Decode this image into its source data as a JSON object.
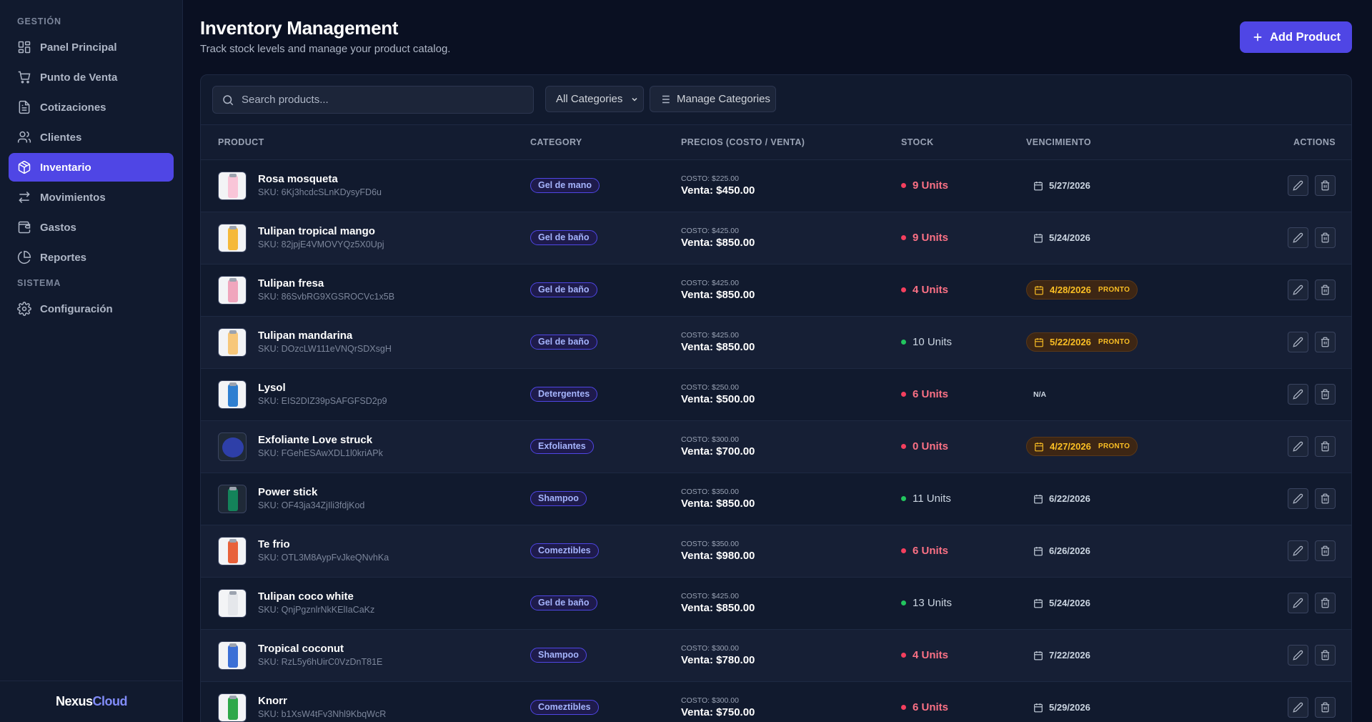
{
  "sidebar": {
    "section_main": "GESTIÓN",
    "section_system": "SISTEMA",
    "items": [
      {
        "label": "Panel Principal",
        "icon": "grid-icon"
      },
      {
        "label": "Punto de Venta",
        "icon": "cart-icon"
      },
      {
        "label": "Cotizaciones",
        "icon": "document-icon"
      },
      {
        "label": "Clientes",
        "icon": "users-icon"
      },
      {
        "label": "Inventario",
        "icon": "box-icon",
        "active": true
      },
      {
        "label": "Movimientos",
        "icon": "arrows-icon"
      },
      {
        "label": "Gastos",
        "icon": "wallet-icon"
      },
      {
        "label": "Reportes",
        "icon": "pie-chart-icon"
      }
    ],
    "system_items": [
      {
        "label": "Configuración",
        "icon": "gear-icon"
      }
    ],
    "brand_part1": "Nexus",
    "brand_part2": "Cloud"
  },
  "header": {
    "title": "Inventory Management",
    "subtitle": "Track stock levels and manage your product catalog.",
    "add_label": "Add Product"
  },
  "toolbar": {
    "search_placeholder": "Search products...",
    "category_filter": "All Categories",
    "manage_label": "Manage Categories"
  },
  "table": {
    "columns": [
      "PRODUCT",
      "CATEGORY",
      "PRECIOS (COSTO / VENTA)",
      "STOCK",
      "VENCIMIENTO",
      "ACTIONS"
    ],
    "rows": [
      {
        "name": "Rosa mosqueta",
        "sku": "SKU: 6Kj3hcdcSLnKDysyFD6u",
        "category": "Gel de mano",
        "cost": "COSTO: $225.00",
        "price": "Venta: $450.00",
        "stock": "9 Units",
        "stock_level": "low",
        "expiry": "5/27/2026",
        "soon": false,
        "thumb_color": "#f9c5d8"
      },
      {
        "name": "Tulipan tropical mango",
        "sku": "SKU: 82jpjE4VMOVYQz5X0Upj",
        "category": "Gel de baño",
        "cost": "COSTO: $425.00",
        "price": "Venta: $850.00",
        "stock": "9 Units",
        "stock_level": "low",
        "expiry": "5/24/2026",
        "soon": false,
        "thumb_color": "#f5b93a"
      },
      {
        "name": "Tulipan fresa",
        "sku": "SKU: 86SvbRG9XGSROCVc1x5B",
        "category": "Gel de baño",
        "cost": "COSTO: $425.00",
        "price": "Venta: $850.00",
        "stock": "4 Units",
        "stock_level": "low",
        "expiry": "4/28/2026",
        "soon": true,
        "thumb_color": "#f0a6bd"
      },
      {
        "name": "Tulipan mandarina",
        "sku": "SKU: DOzcLW111eVNQrSDXsgH",
        "category": "Gel de baño",
        "cost": "COSTO: $425.00",
        "price": "Venta: $850.00",
        "stock": "10 Units",
        "stock_level": "ok",
        "expiry": "5/22/2026",
        "soon": true,
        "thumb_color": "#f7c77a"
      },
      {
        "name": "Lysol",
        "sku": "SKU: EIS2DIZ39pSAFGFSD2p9",
        "category": "Detergentes",
        "cost": "COSTO: $250.00",
        "price": "Venta: $500.00",
        "stock": "6 Units",
        "stock_level": "low",
        "expiry": "N/A",
        "soon": false,
        "na": true,
        "thumb_color": "#2f7fd1"
      },
      {
        "name": "Exfoliante Love struck",
        "sku": "SKU: FGehESAwXDL1l0kriAPk",
        "category": "Exfoliantes",
        "cost": "COSTO: $300.00",
        "price": "Venta: $700.00",
        "stock": "0 Units",
        "stock_level": "low",
        "expiry": "4/27/2026",
        "soon": true,
        "thumb_color": "#2e3fa8",
        "round": true
      },
      {
        "name": "Power stick",
        "sku": "SKU: OF43ja34ZjIli3fdjKod",
        "category": "Shampoo",
        "cost": "COSTO: $350.00",
        "price": "Venta: $850.00",
        "stock": "11 Units",
        "stock_level": "ok",
        "expiry": "6/22/2026",
        "soon": false,
        "thumb_color": "#14835a",
        "dark": true
      },
      {
        "name": "Te frio",
        "sku": "SKU: OTL3M8AypFvJkeQNvhKa",
        "category": "Comeztibles",
        "cost": "COSTO: $350.00",
        "price": "Venta: $980.00",
        "stock": "6 Units",
        "stock_level": "low",
        "expiry": "6/26/2026",
        "soon": false,
        "thumb_color": "#e8613a"
      },
      {
        "name": "Tulipan coco white",
        "sku": "SKU: QnjPgznlrNkKElIaCaKz",
        "category": "Gel de baño",
        "cost": "COSTO: $425.00",
        "price": "Venta: $850.00",
        "stock": "13 Units",
        "stock_level": "ok",
        "expiry": "5/24/2026",
        "soon": false,
        "thumb_color": "#e5e7eb"
      },
      {
        "name": "Tropical coconut",
        "sku": "SKU: RzL5y6hUirC0VzDnT81E",
        "category": "Shampoo",
        "cost": "COSTO: $300.00",
        "price": "Venta: $780.00",
        "stock": "4 Units",
        "stock_level": "low",
        "expiry": "7/22/2026",
        "soon": false,
        "thumb_color": "#3b6fd6"
      },
      {
        "name": "Knorr",
        "sku": "SKU: b1XsW4tFv3Nhl9KbqWcR",
        "category": "Comeztibles",
        "cost": "COSTO: $300.00",
        "price": "Venta: $750.00",
        "stock": "6 Units",
        "stock_level": "low",
        "expiry": "5/29/2026",
        "soon": false,
        "thumb_color": "#2ea84a"
      }
    ],
    "pronto_label": "PRONTO"
  },
  "colors": {
    "accent": "#4f46e5",
    "background": "#0a1022",
    "panel": "#111a2e",
    "low_stock": "#f43f5e",
    "ok_stock": "#22c55e",
    "soon": "#fbbf24"
  }
}
